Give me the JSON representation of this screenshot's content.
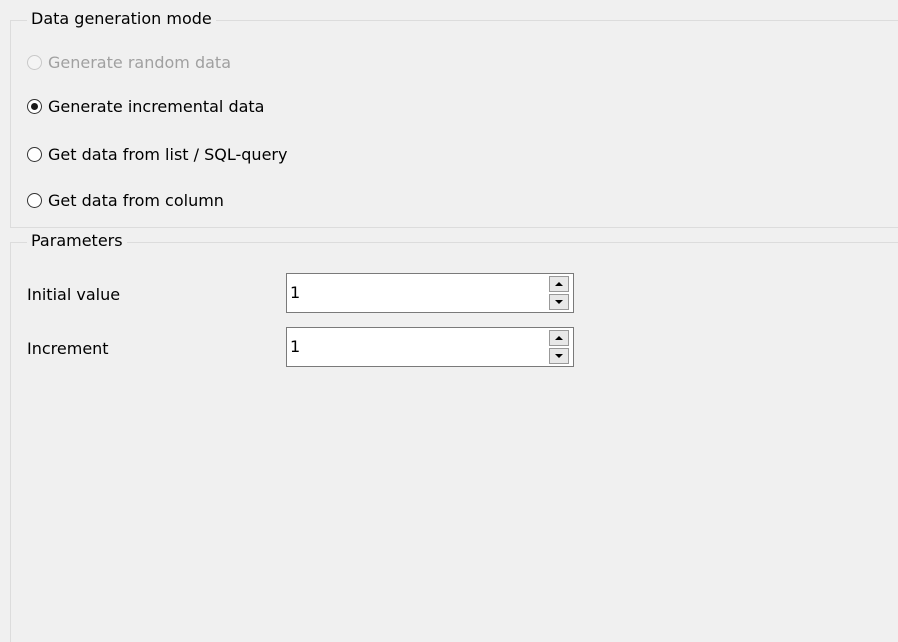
{
  "mode_group": {
    "title": "Data generation mode",
    "options": [
      {
        "label": "Generate random data",
        "checked": false,
        "disabled": true
      },
      {
        "label": "Generate incremental data",
        "checked": true,
        "disabled": false
      },
      {
        "label": "Get data from list / SQL-query",
        "checked": false,
        "disabled": false
      },
      {
        "label": "Get data from column",
        "checked": false,
        "disabled": false
      }
    ]
  },
  "params_group": {
    "title": "Parameters",
    "initial_value": {
      "label": "Initial value",
      "value": "1"
    },
    "increment": {
      "label": "Increment",
      "value": "1"
    }
  },
  "icons": {
    "spin_up": "triangle-up-icon",
    "spin_down": "triangle-down-icon"
  },
  "colors": {
    "background": "#f0f0f0",
    "disabled_text": "#a0a0a0",
    "group_border": "#dcdcdc"
  }
}
